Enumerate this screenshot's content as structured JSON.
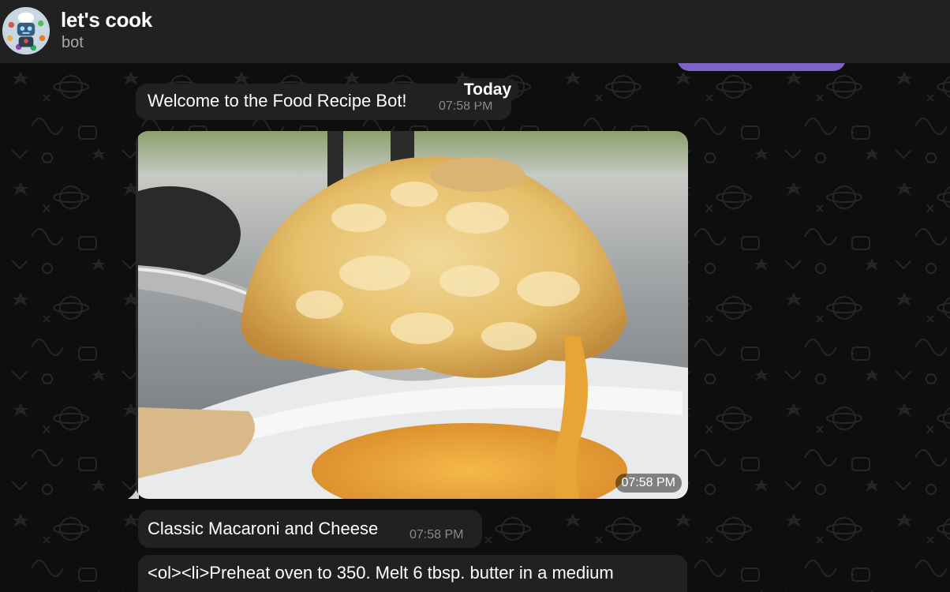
{
  "header": {
    "title": "let's cook",
    "subtitle": "bot",
    "avatar_icon": "chef-robot-avatar"
  },
  "chat": {
    "date_separator": "Today",
    "messages": [
      {
        "type": "text",
        "text": "Welcome to the Food Recipe Bot!",
        "time": "07:58 PM"
      },
      {
        "type": "photo",
        "description_icon": "mac-and-cheese-photo",
        "time": "07:58 PM"
      },
      {
        "type": "text",
        "text": "Classic Macaroni and Cheese",
        "time": "07:58 PM"
      },
      {
        "type": "text",
        "text": "<ol><li>Preheat oven to 350. Melt 6 tbsp. butter in a medium"
      }
    ]
  },
  "colors": {
    "header_bg": "#212121",
    "bubble_bg": "#212121",
    "outgoing_bubble": "#7d63c8",
    "chat_bg": "#0e0e0e",
    "time_text": "#8a8a8a"
  }
}
